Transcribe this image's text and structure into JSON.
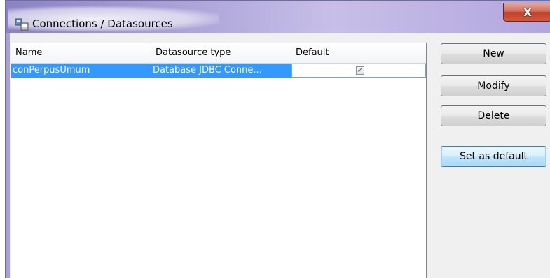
{
  "window": {
    "title": "Connections / Datasources",
    "close_glyph": "X"
  },
  "table": {
    "columns": [
      "Name",
      "Datasource type",
      "Default"
    ],
    "rows": [
      {
        "name": "conPerpusUmum",
        "type": "Database JDBC Conne...",
        "default": true
      }
    ],
    "checkbox_glyph": "✓"
  },
  "buttons": {
    "new": "New",
    "modify": "Modify",
    "delete": "Delete",
    "set_default": "Set as default"
  },
  "colors": {
    "selection": "#3399ff",
    "title_bar": "#b9b0e2",
    "close_button": "#c94a30"
  }
}
